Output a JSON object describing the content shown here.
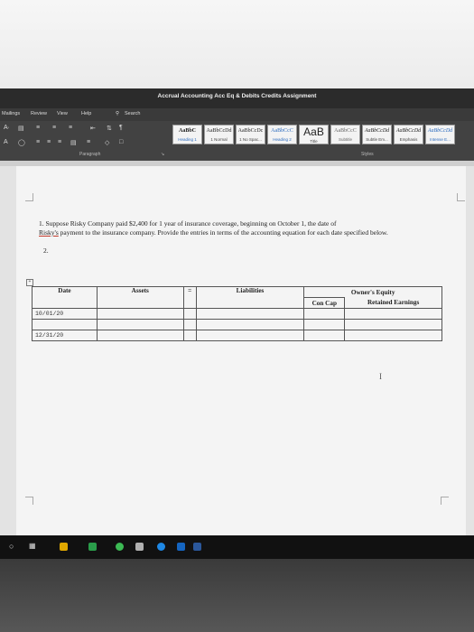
{
  "window": {
    "title": "Accrual Accounting Acc Eq & Debits Credits Assignment"
  },
  "ribbon": {
    "tabs": [
      "Mailings",
      "Review",
      "View",
      "Help"
    ],
    "search_label": "Search",
    "paragraph_group_label": "Paragraph",
    "styles_group_label": "Styles",
    "styles": [
      {
        "sample": "AaBbC",
        "name": "Heading 1"
      },
      {
        "sample": "AaBbCcDd",
        "name": "1 Normal"
      },
      {
        "sample": "AaBbCcDc",
        "name": "1 No Spac..."
      },
      {
        "sample": "AaBbCcC",
        "name": "Heading 2"
      },
      {
        "sample": "AaB",
        "name": "Title"
      },
      {
        "sample": "AaBbCcC",
        "name": "Subtitle"
      },
      {
        "sample": "AaBbCcDd",
        "name": "Subtle Em..."
      },
      {
        "sample": "AaBbCcDd",
        "name": "Emphasis"
      },
      {
        "sample": "AaBbCcDd",
        "name": "Intense E..."
      }
    ]
  },
  "document": {
    "q1_prefix": "1. Suppose Risky Company paid $2,400 for 1 year of insurance coverage, beginning on October 1, the date of",
    "q1_risky": "Risky's",
    "q1_rest": " payment to the insurance company. Provide the entries in terms of the accounting equation for each date specified below.",
    "q2_number": "2.",
    "table": {
      "headers": {
        "date": "Date",
        "assets": "Assets",
        "equals": "=",
        "liabilities": "Liabilities",
        "equity": "Owner's Equity",
        "con_cap": "Con Cap",
        "retained": "Retained Earnings"
      },
      "dates": [
        "10/01/20",
        "12/31/20"
      ]
    },
    "cursor": "I"
  }
}
